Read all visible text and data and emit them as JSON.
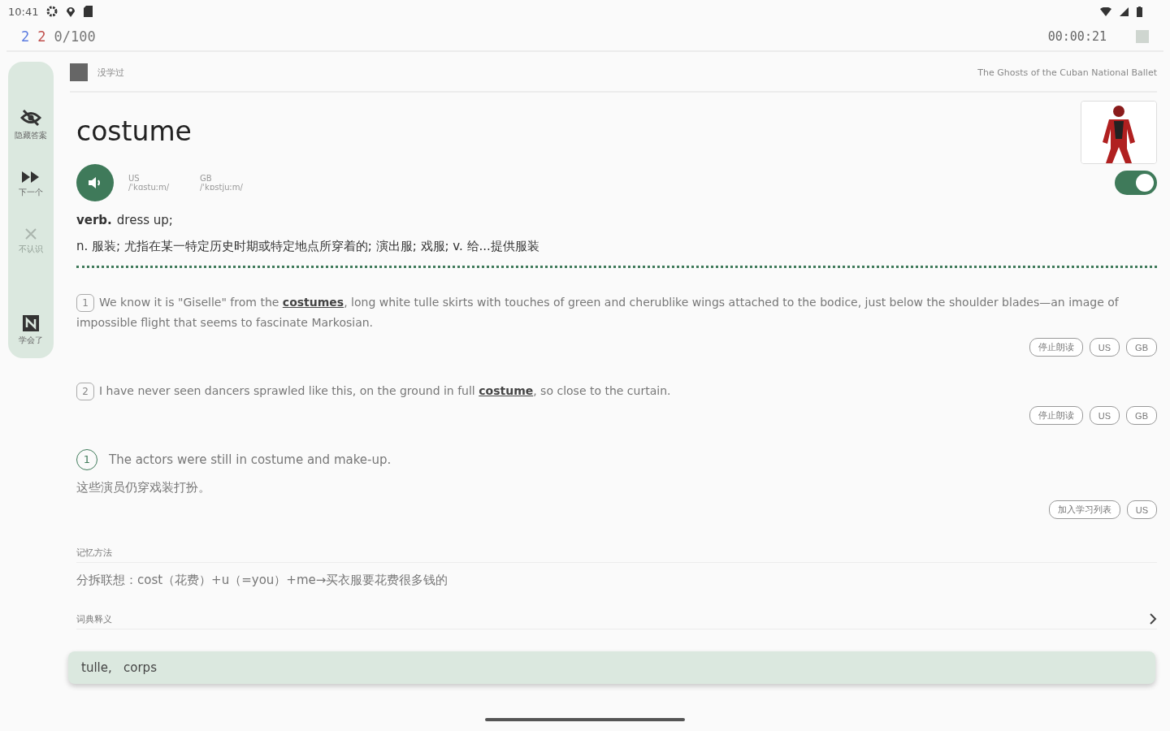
{
  "status_bar": {
    "time": "10:41"
  },
  "top_bar": {
    "counts": [
      {
        "text": "2",
        "color": "#5b7be0"
      },
      {
        "text": "2",
        "color": "#c0504d"
      },
      {
        "text": "0/100",
        "color": "#777777"
      }
    ],
    "timer": "00:00:21"
  },
  "sidebar": {
    "items": [
      {
        "kind": "hide",
        "label": "隐藏答案",
        "disabled": false
      },
      {
        "kind": "next",
        "label": "下一个",
        "disabled": false
      },
      {
        "kind": "unknown",
        "label": "不认识",
        "disabled": true
      },
      {
        "kind": "learned",
        "label": "学会了",
        "disabled": false
      }
    ]
  },
  "header": {
    "status": "没学过",
    "source": "The Ghosts of the Cuban National Ballet"
  },
  "word": {
    "text": "costume",
    "phonetics": [
      {
        "region": "US",
        "ipa": "/ˈkɑstuːm/"
      },
      {
        "region": "GB",
        "ipa": "/ˈkɒstjuːm/"
      }
    ],
    "switch_on": true
  },
  "definitions": [
    {
      "pos": "verb.",
      "text": "dress up;"
    },
    {
      "text": "n. 服装; 尤指在某一特定历史时期或特定地点所穿着的; 演出服; 戏服; v. 给...提供服装"
    }
  ],
  "sentences": [
    {
      "number": "1",
      "before": "We know it is \"Giselle\" from the ",
      "word": "costumes",
      "after": ", long white tulle skirts with touches of green and cherublike wings attached to the bodice, just below the shoulder blades—an image of impossible flight that seems to fascinate Markosian.",
      "buttons": [
        "停止朗读",
        "US",
        "GB"
      ]
    },
    {
      "number": "2",
      "before": "I have never seen dancers sprawled like this, on the ground in full ",
      "word": "costume",
      "after": ", so close to the curtain.",
      "buttons": [
        "停止朗读",
        "US",
        "GB"
      ]
    }
  ],
  "example": {
    "number": "1",
    "text": "The actors were still in costume and make-up.",
    "translation": "这些演员仍穿戏装打扮。",
    "buttons": [
      "加入学习列表",
      "US"
    ]
  },
  "memory": {
    "title": "记忆方法",
    "text": "分拆联想：cost（花费）+u（=you）+me→买衣服要花费很多钱的"
  },
  "dictionary": {
    "title": "词典释义"
  },
  "bottom_bar": {
    "text": "tulle,   corps"
  }
}
